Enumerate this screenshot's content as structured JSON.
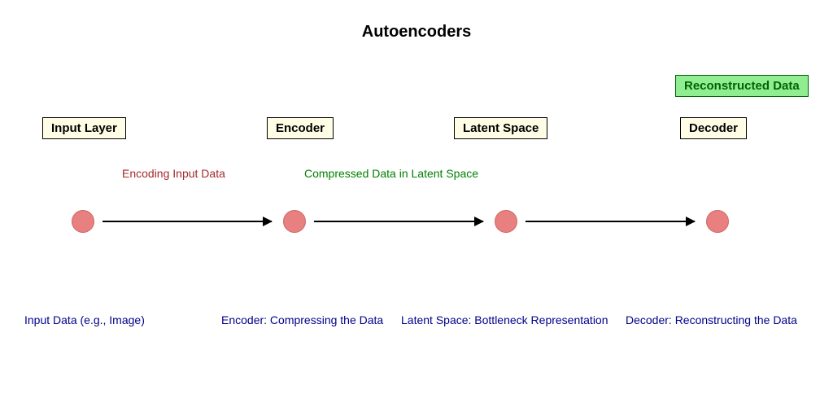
{
  "title": "Autoencoders",
  "boxes": {
    "input": "Input Layer",
    "encoder": "Encoder",
    "latent": "Latent Space",
    "decoder": "Decoder",
    "reconstructed": "Reconstructed Data"
  },
  "edgeLabels": {
    "encoding": "Encoding Input Data",
    "compressed": "Compressed Data in Latent Space"
  },
  "captions": {
    "input": "Input Data (e.g., Image)",
    "encoder": "Encoder: Compressing the Data",
    "latent": "Latent Space: Bottleneck Representation",
    "decoder": "Decoder: Reconstructing the Data"
  }
}
